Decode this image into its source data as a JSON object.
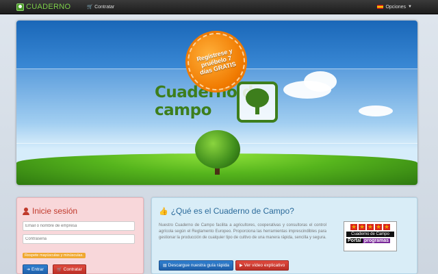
{
  "navbar": {
    "brand": "CUADERNO",
    "contratar": "Contratar",
    "opciones": "Opciones"
  },
  "hero": {
    "badge": "Regístrese y pruébelo 7 días GRATIS",
    "logo_line1": "Cuaderno de",
    "logo_line2": "campo"
  },
  "login": {
    "title": "Inicie sesión",
    "email_placeholder": "Email o nombre de empresa",
    "password_placeholder": "Contraseña",
    "case_warning": "Respete mayúsculas y minúsculas.",
    "enter_label": "Entrar",
    "contract_label": "Contratar"
  },
  "info": {
    "title": "¿Qué es el Cuaderno de Campo?",
    "description": "Nuestro Cuaderno de Campo facilita a agricultores, cooperativas y consultoras el control agrícola según el Reglamento Europeo. Proporciona las herramientas imprescindibles para gestionar la producción de cualquier tipo de cultivo de una manera rápida, sencilla y segura.",
    "download_label": "Descargue nuestra guía rápida",
    "video_label": "Ver vídeo explicativo",
    "portal_title": "Cuaderno de Campo",
    "portal_word1": "Portal",
    "portal_word2": "programas"
  },
  "colors": {
    "brand_green": "#7dd04a",
    "login_title": "#c0392b",
    "info_title": "#2a6a9a"
  }
}
